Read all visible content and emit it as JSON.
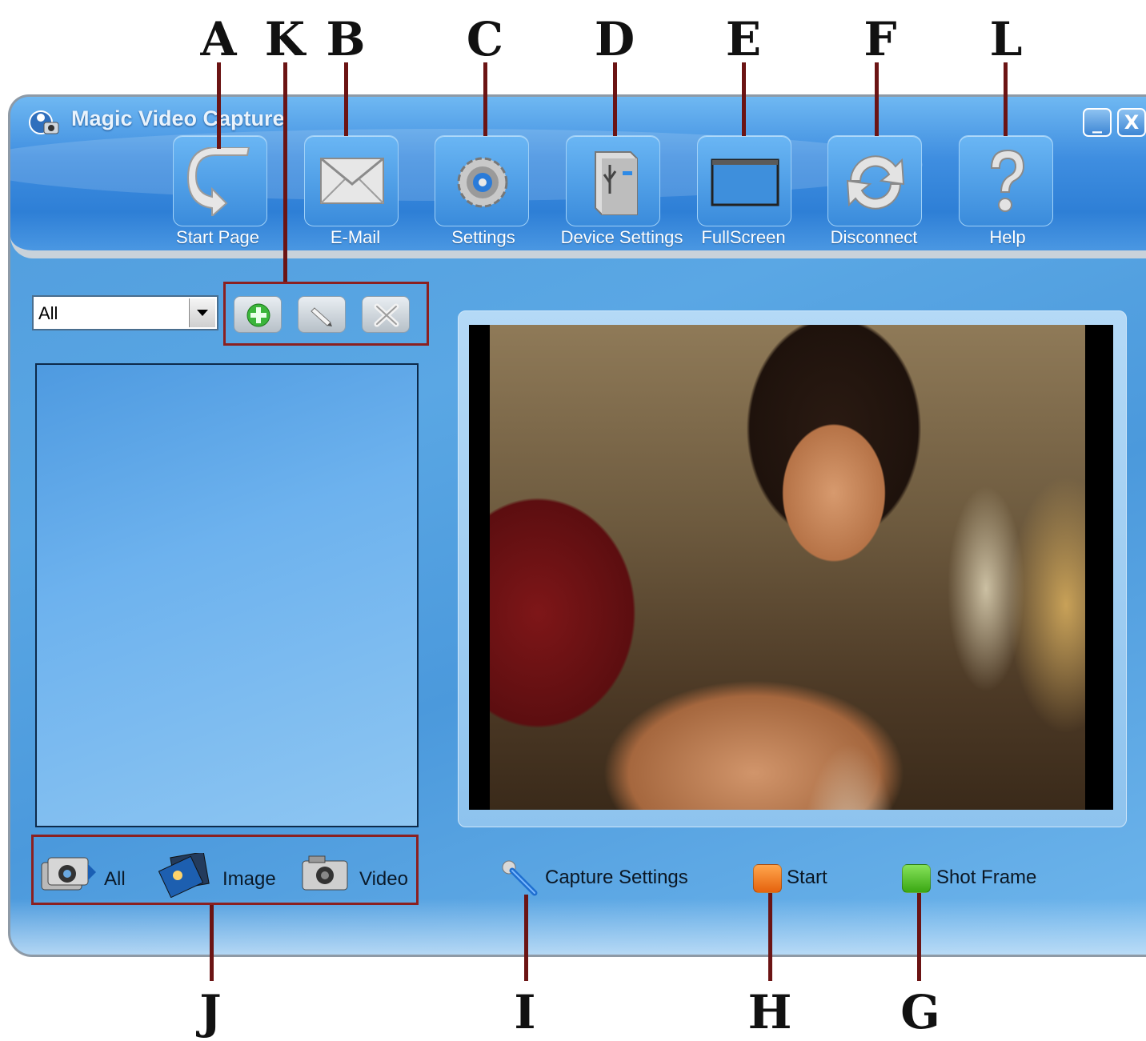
{
  "app": {
    "title": "Magic Video Capture"
  },
  "toolbar": {
    "items": [
      {
        "label": "Start Page",
        "icon": "start-page-arrow-icon"
      },
      {
        "label": "E-Mail",
        "icon": "envelope-icon"
      },
      {
        "label": "Settings",
        "icon": "gear-icon"
      },
      {
        "label": "Device Settings",
        "icon": "usb-device-icon"
      },
      {
        "label": "FullScreen",
        "icon": "fullscreen-frame-icon"
      },
      {
        "label": "Disconnect",
        "icon": "refresh-arrows-icon"
      },
      {
        "label": "Help",
        "icon": "question-mark-icon"
      }
    ]
  },
  "window_controls": {
    "minimize": "_",
    "close": "X"
  },
  "left_panel": {
    "category_select": {
      "value": "All"
    },
    "action_buttons": [
      "add-icon",
      "edit-pencil-icon",
      "delete-icon"
    ],
    "filters": [
      {
        "label": "All",
        "icon": "camera-stack-icon"
      },
      {
        "label": "Image",
        "icon": "photo-icon"
      },
      {
        "label": "Video",
        "icon": "video-camera-icon"
      }
    ]
  },
  "capture_controls": {
    "capture_settings_label": "Capture Settings",
    "start_label": "Start",
    "shot_frame_label": "Shot Frame",
    "start_color": "#f07a18",
    "shot_frame_color": "#4cc21c"
  },
  "annotations": {
    "top": [
      "A",
      "K",
      "B",
      "C",
      "D",
      "E",
      "F",
      "L"
    ],
    "bottom": [
      "J",
      "I",
      "H",
      "G"
    ]
  }
}
